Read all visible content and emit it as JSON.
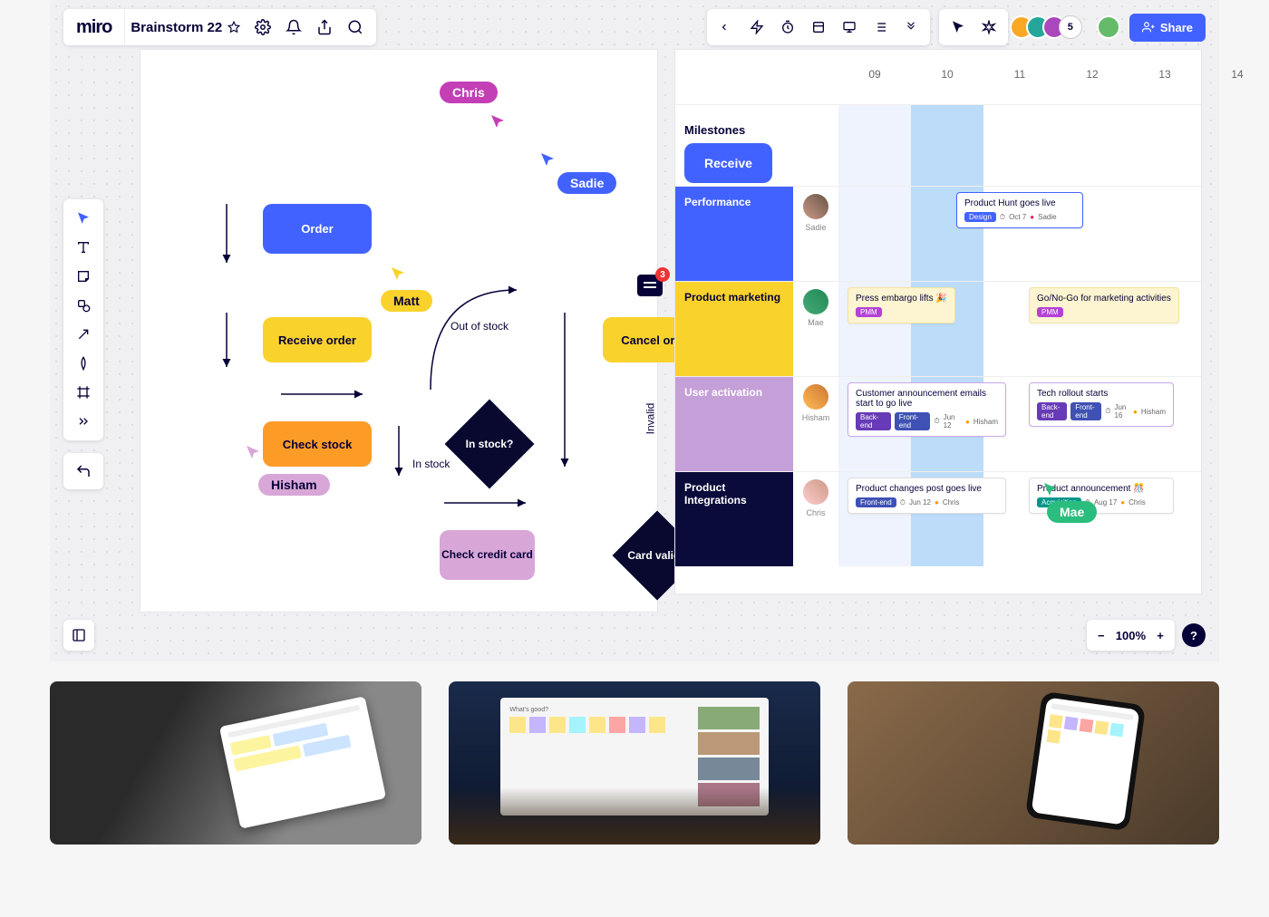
{
  "logo": "miro",
  "board_name": "Brainstorm 22",
  "share_label": "Share",
  "collab_count": "5",
  "zoom": "100%",
  "help": "?",
  "comment_count": "3",
  "flow": {
    "order": "Order",
    "receive": "Receive order",
    "check": "Check stock",
    "instock_q": "In stock?",
    "checkcc": "Check credit card",
    "cancel": "Cancel order",
    "cardvalid_q": "Card valid?",
    "lbl_out": "Out of stock",
    "lbl_in": "In stock",
    "lbl_inv": "Invalid"
  },
  "cursors": {
    "chris": "Chris",
    "sadie": "Sadie",
    "matt": "Matt",
    "hisham": "Hisham",
    "mae": "Mae"
  },
  "timeline": {
    "days": [
      "09",
      "10",
      "11",
      "12",
      "13",
      "14"
    ],
    "milestones": "Milestones",
    "receive": "Receive",
    "rows": [
      {
        "label": "Performance",
        "person": "Sadie",
        "color": "#4262ff"
      },
      {
        "label": "Product marketing",
        "person": "Mae",
        "color": "#f9d22b"
      },
      {
        "label": "User activation",
        "person": "Hisham",
        "color": "#c59fd8"
      },
      {
        "label": "Product Integrations",
        "person": "Chris",
        "color": "#0b0b3b"
      }
    ],
    "cards": {
      "ph": {
        "title": "Product Hunt goes live",
        "tag": "Design",
        "date": "Oct 7",
        "who": "Sadie"
      },
      "embargo": {
        "title": "Press embargo lifts 🎉",
        "tag": "PMM"
      },
      "gonogo": {
        "title": "Go/No-Go for marketing activities",
        "tag": "PMM"
      },
      "cust": {
        "title": "Customer announcement emails start to go live",
        "t1": "Back-end",
        "t2": "Front-end",
        "date": "Jun 12",
        "who": "Hisham"
      },
      "tech": {
        "title": "Tech rollout starts",
        "t1": "Back-end",
        "t2": "Front-end",
        "date": "Jun 16",
        "who": "Hisham"
      },
      "changes": {
        "title": "Product changes post goes live",
        "t1": "Front-end",
        "date": "Jun 12",
        "who": "Chris"
      },
      "announce": {
        "title": "Product announcement 🎊",
        "t1": "Acquisition",
        "date": "Aug 17",
        "who": "Chris"
      }
    }
  }
}
